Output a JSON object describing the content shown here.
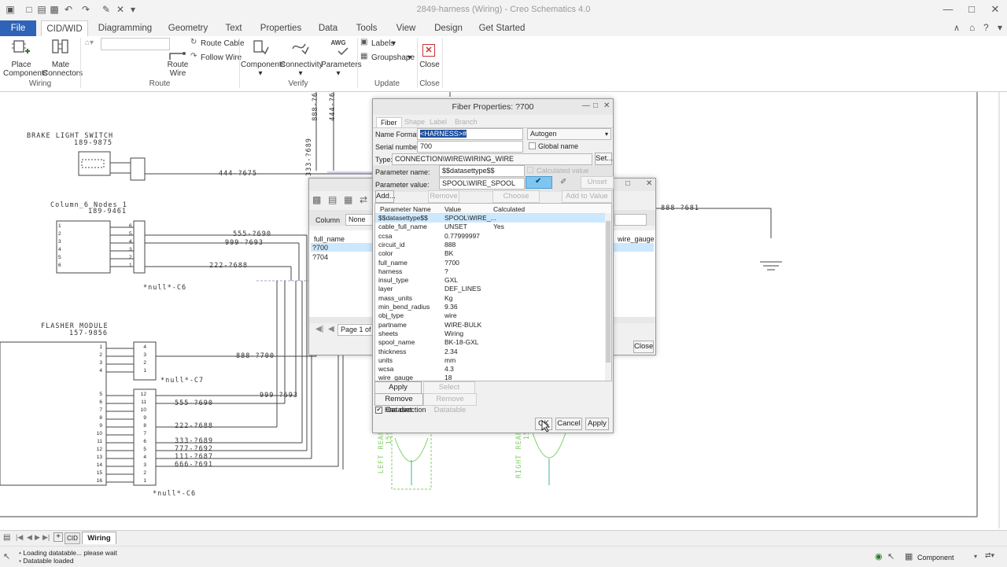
{
  "window": {
    "title": "2849-harness (Wiring) - Creo Schematics 4.0"
  },
  "tabs": [
    "File",
    "CID/WID",
    "Diagramming",
    "Geometry",
    "Text",
    "Properties",
    "Data",
    "Tools",
    "View",
    "Design",
    "Get Started"
  ],
  "ribbon": {
    "place_components": [
      "Place",
      "Components"
    ],
    "mate_connectors": [
      "Mate",
      "Connectors"
    ],
    "route_wire": [
      "Route",
      "Wire"
    ],
    "route_cable": "Route Cable",
    "follow_wire": "Follow Wire",
    "components": "Components",
    "connectivity": "Connectivity",
    "parameters": "Parameters",
    "parameters_badge": "AWG",
    "labels": "Labels",
    "groupshape": "Groupshape",
    "close": "Close",
    "groups": {
      "wiring": "Wiring",
      "route": "Route",
      "verify": "Verify",
      "update": "Update",
      "close": "Close"
    }
  },
  "schematic": {
    "brake_light_switch": "BRAKE LIGHT SWITCH",
    "brake_id": "189-9875",
    "wire_444": "444-?675",
    "column": "Column_6_Nodes_1",
    "column_id": "189-9461",
    "null_c6_top": "*null*-C6",
    "wire_555_top": "555-?690",
    "wire_999_top": "999-?693",
    "wire_222_top": "222-?688",
    "flasher": "FLASHER MODULE",
    "flasher_id": "157-9856",
    "null_c7": "*null*-C7",
    "wire_888_mid": "888-?700",
    "wire_999_low": "999-?693",
    "wire_555_low": "555-?690",
    "wire_222_low": "222-?688",
    "wire_333": "333-?689",
    "wire_777": "777-?692",
    "wire_111": "111-?687",
    "wire_666": "666-?691",
    "null_c6_bottom": "*null*-C6",
    "wire_888_right": "888-?681",
    "wire_888_vert": "888-?6",
    "wire_444_vert": "444-?6",
    "wire_333_vert": "333-?689",
    "left_rear": "LEFT REAR",
    "left_rear_id": "159",
    "right_rear": "RIGHT REAR",
    "right_rear_id": "15",
    "flasher_pins_left": [
      "1",
      "2",
      "3",
      "4",
      "5",
      "6",
      "7",
      "8",
      "9",
      "10",
      "11",
      "12",
      "13",
      "14",
      "15",
      "16"
    ],
    "flasher_pins_c7": [
      "4",
      "3",
      "2",
      "1"
    ],
    "flasher_pins_c6": [
      "12",
      "11",
      "10",
      "9",
      "8",
      "7",
      "6",
      "5",
      "4",
      "3",
      "2",
      "1"
    ],
    "column_pins_left": [
      "1",
      "2",
      "3",
      "4",
      "5",
      "6"
    ],
    "column_pins_right": [
      "6",
      "5",
      "4",
      "3",
      "2",
      "1"
    ]
  },
  "back_dialog": {
    "column_label": "Column",
    "column_value": "None",
    "header": "full_name",
    "rows": [
      "?700",
      "?704"
    ],
    "right_header": "wire_gauge",
    "page": "Page 1 of 1",
    "close": "Close"
  },
  "fiber_dialog": {
    "title": "Fiber Properties: ?700",
    "tabs": [
      "Fiber",
      "Shape",
      "Label",
      "Branch"
    ],
    "name_format_label": "Name Format:",
    "name_format_value": "<HARNESS>#",
    "name_mode": "Autogen",
    "serial_label": "Serial number:",
    "serial_value": "700",
    "global_name": "Global name",
    "type_label": "Type:",
    "type_value": "CONNECTION\\WIRE\\WIRING_WIRE",
    "set_button": "Set...",
    "param_name_label": "Parameter name:",
    "param_name_value": "$$datasettype$$",
    "calculated_value": "Calculated value",
    "param_value_label": "Parameter value:",
    "param_value_value": "SPOOL\\WIRE_SPOOL",
    "unset": "Unset",
    "add": "Add...",
    "remove": "Remove",
    "choose_value": "Choose Value...",
    "add_to_value_list": "Add to Value List",
    "columns": [
      "Parameter Name",
      "Value",
      "Calculated"
    ],
    "params": [
      [
        "$$datasettype$$",
        "SPOOL\\WIRE_...",
        ""
      ],
      [
        "cable_full_name",
        "UNSET",
        "Yes"
      ],
      [
        "ccsa",
        "0.77999997",
        ""
      ],
      [
        "circuit_id",
        "888",
        ""
      ],
      [
        "color",
        "BK",
        ""
      ],
      [
        "full_name",
        "?700",
        ""
      ],
      [
        "harness",
        "?",
        ""
      ],
      [
        "insul_type",
        "GXL",
        ""
      ],
      [
        "layer",
        "DEF_LINES",
        ""
      ],
      [
        "mass_units",
        "Kg",
        ""
      ],
      [
        "min_bend_radius",
        "9.36",
        ""
      ],
      [
        "obj_type",
        "wire",
        ""
      ],
      [
        "partname",
        "WIRE-BULK",
        ""
      ],
      [
        "sheets",
        "Wiring",
        ""
      ],
      [
        "spool_name",
        "BK-18-GXL",
        ""
      ],
      [
        "thickness",
        "2.34",
        ""
      ],
      [
        "units",
        "mm",
        ""
      ],
      [
        "wcsa",
        "4.3",
        ""
      ],
      [
        "wire_gauge",
        "18",
        ""
      ]
    ],
    "apply_dataset": "Apply Dataset...",
    "select_datatable": "Select Datatable...",
    "remove_dataset": "Remove Dataset",
    "remove_datatable": "Remove Datatable",
    "has_direction": "Has direction",
    "ok": "OK",
    "cancel": "Cancel",
    "apply": "Apply"
  },
  "sheets": [
    "CID",
    "Wiring"
  ],
  "status": {
    "line1": "Loading datatable... please wait",
    "line2": "Datatable loaded",
    "filter": "Component"
  },
  "colors": {
    "accent": "#2f63b8",
    "selection": "#cce8ff",
    "green_symbols": "#7fcf63",
    "cyan_symbols": "#3ab0a0"
  }
}
